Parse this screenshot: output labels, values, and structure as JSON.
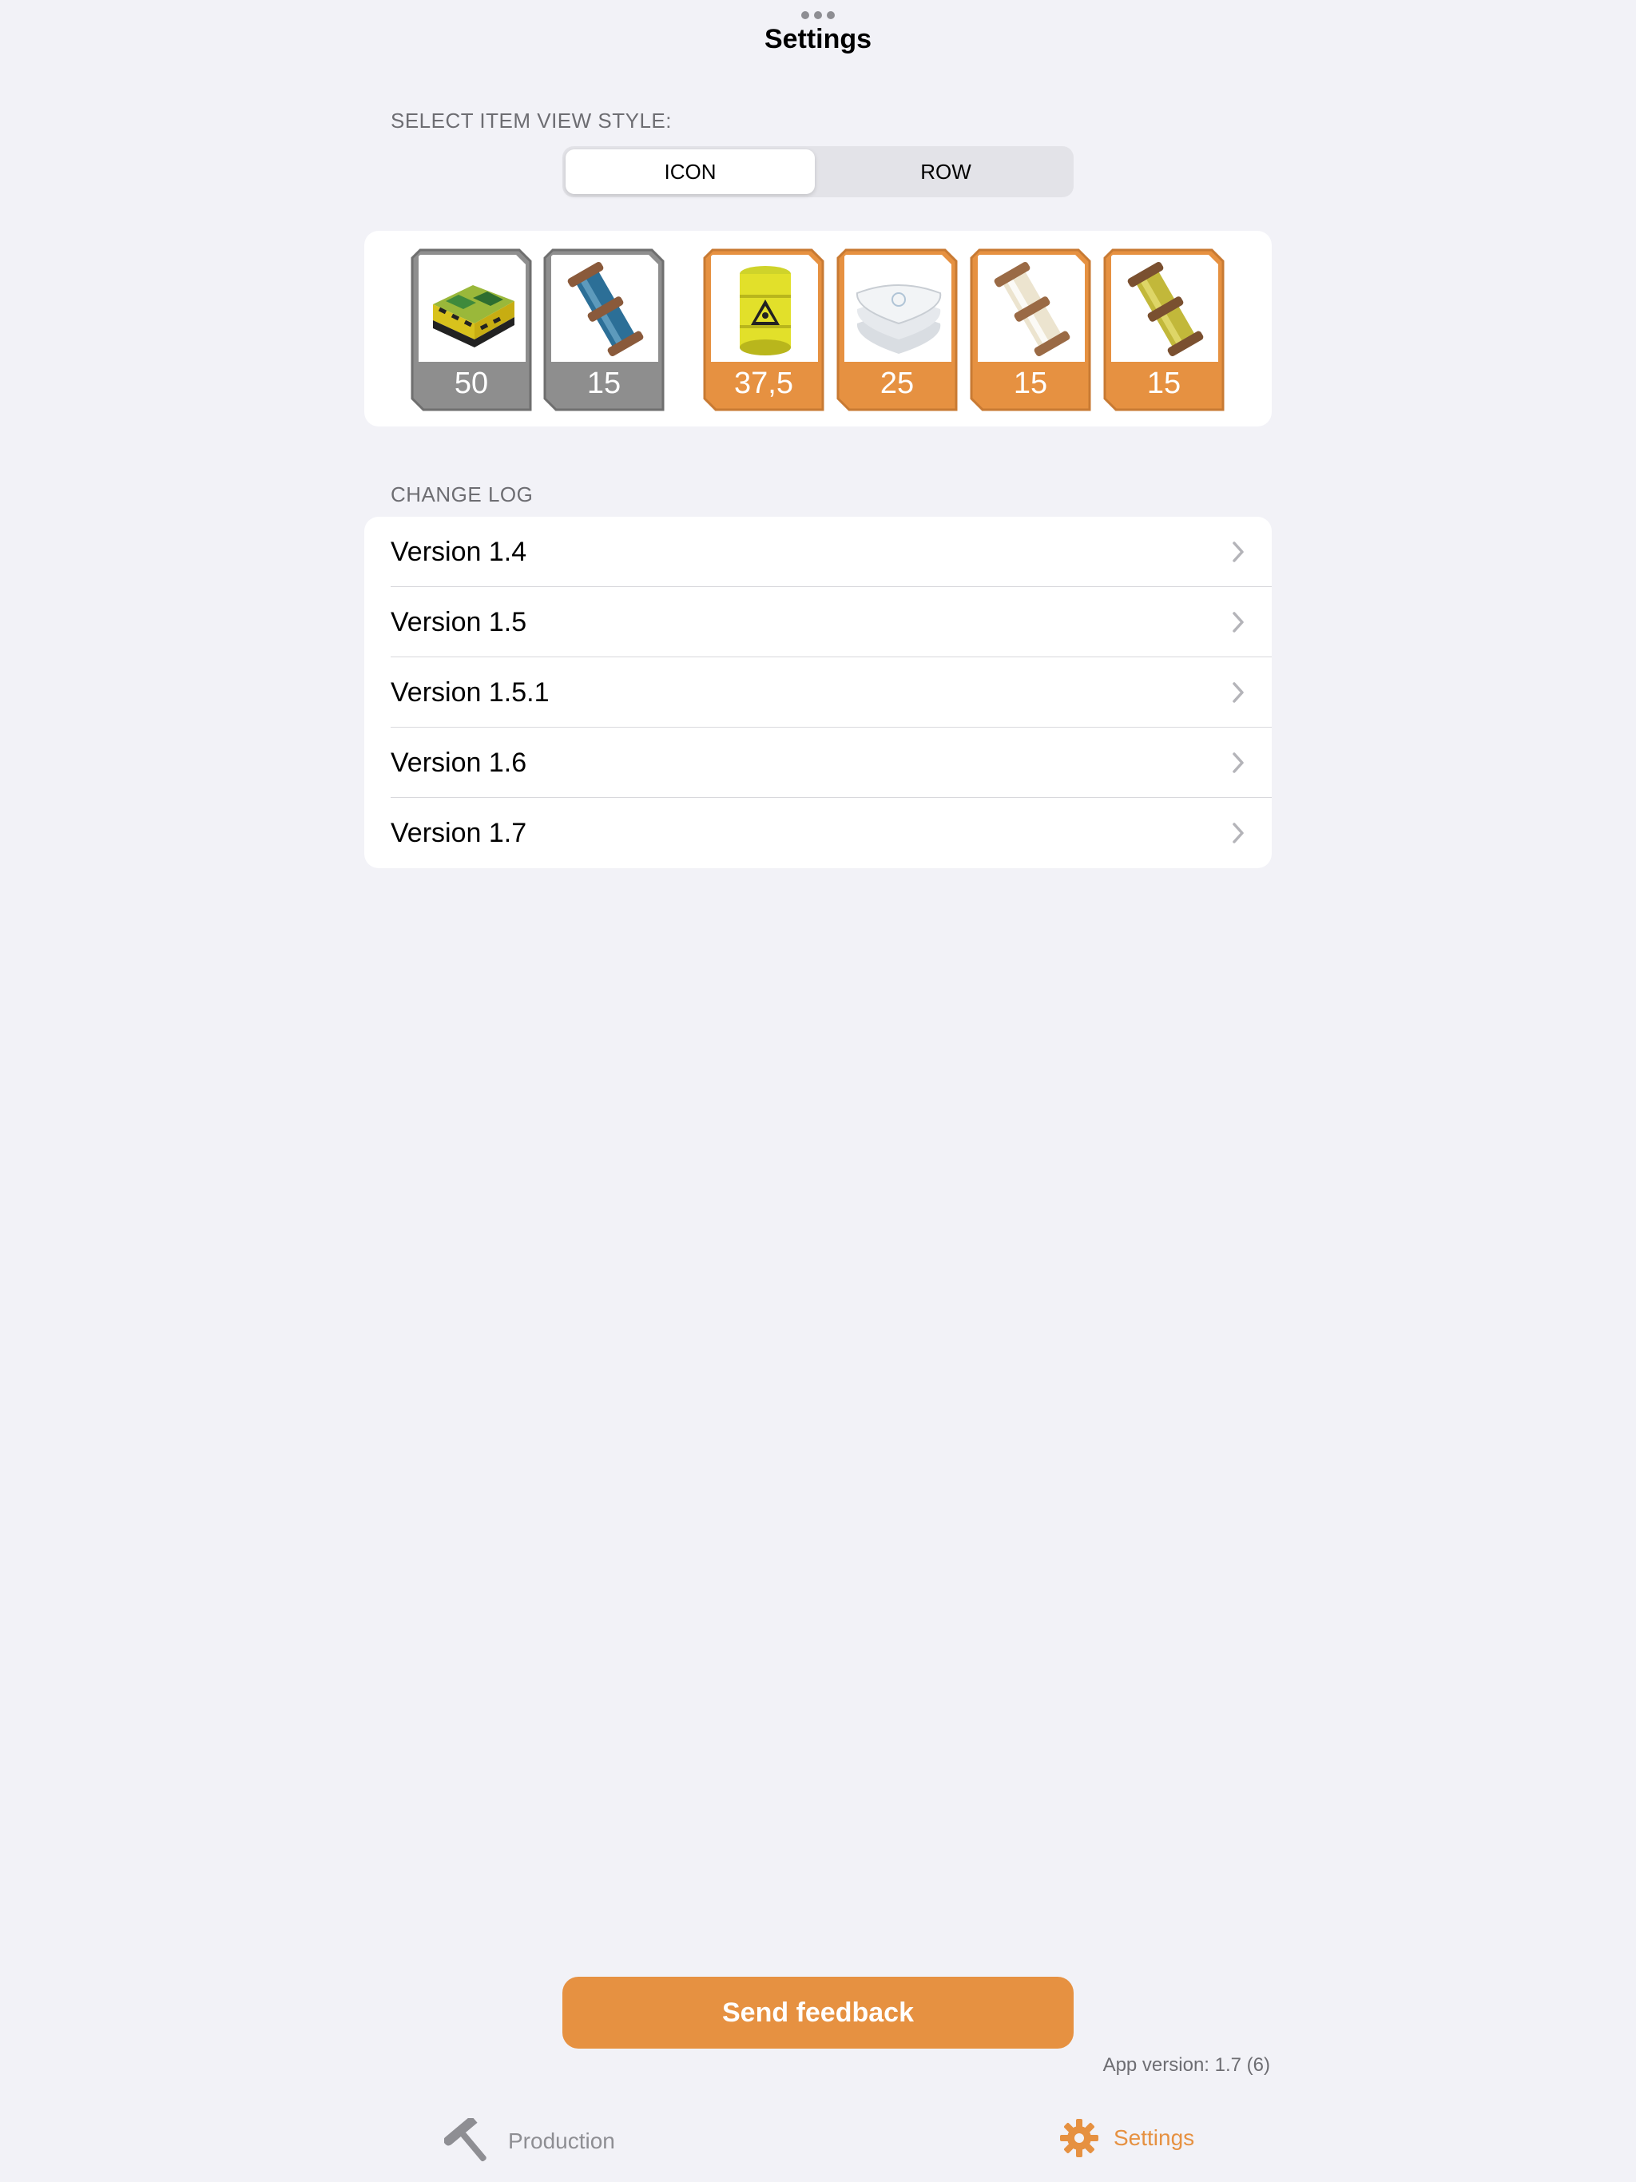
{
  "header": {
    "title": "Settings"
  },
  "view_style": {
    "label": "SELECT ITEM VIEW STYLE:",
    "options": [
      "ICON",
      "ROW"
    ],
    "selected": "ICON"
  },
  "items": [
    {
      "value": "50",
      "color": "#8e8e8e",
      "icon": "circuit-crate-icon"
    },
    {
      "value": "15",
      "color": "#8e8e8e",
      "icon": "blue-capsule-icon"
    },
    {
      "value": "37,5",
      "color": "#e69141",
      "icon": "radioactive-barrel-icon"
    },
    {
      "value": "25",
      "color": "#e69141",
      "icon": "white-bags-icon"
    },
    {
      "value": "15",
      "color": "#e69141",
      "icon": "white-capsule-icon"
    },
    {
      "value": "15",
      "color": "#e69141",
      "icon": "yellow-capsule-icon"
    }
  ],
  "changelog": {
    "label": "CHANGE LOG",
    "versions": [
      "Version 1.4",
      "Version 1.5",
      "Version 1.5.1",
      "Version 1.6",
      "Version 1.7"
    ]
  },
  "feedback_button": "Send feedback",
  "app_version": "App version: 1.7 (6)",
  "tabs": [
    {
      "label": "Production",
      "icon": "hammer-icon",
      "color": "#8e8e93"
    },
    {
      "label": "Settings",
      "icon": "gear-icon",
      "color": "#e69141",
      "active": true
    }
  ]
}
